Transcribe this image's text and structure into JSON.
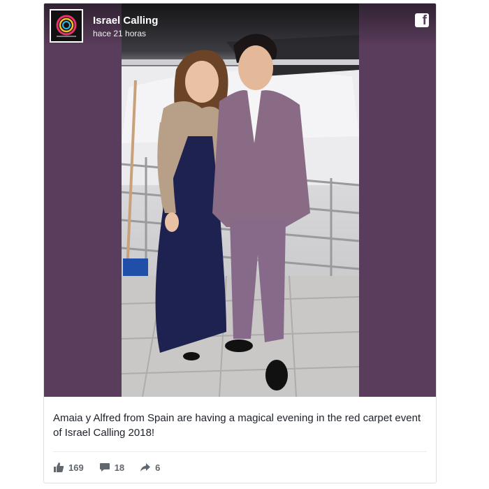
{
  "post": {
    "page_name": "Israel Calling",
    "timestamp": "hace 21 horas",
    "caption": "Amaia y Alfred from Spain are having a magical evening in the red carpet event of Israel Calling 2018!",
    "brand_icon": "facebook-f-icon",
    "stats": {
      "likes": "169",
      "comments": "18",
      "shares": "6"
    },
    "icons": {
      "like": "thumbs-up-icon",
      "comment": "comment-icon",
      "share": "share-arrow-icon"
    },
    "colors": {
      "media_background": "#5a3d5c",
      "stat_text": "#606770",
      "caption_text": "#1d2129"
    }
  }
}
